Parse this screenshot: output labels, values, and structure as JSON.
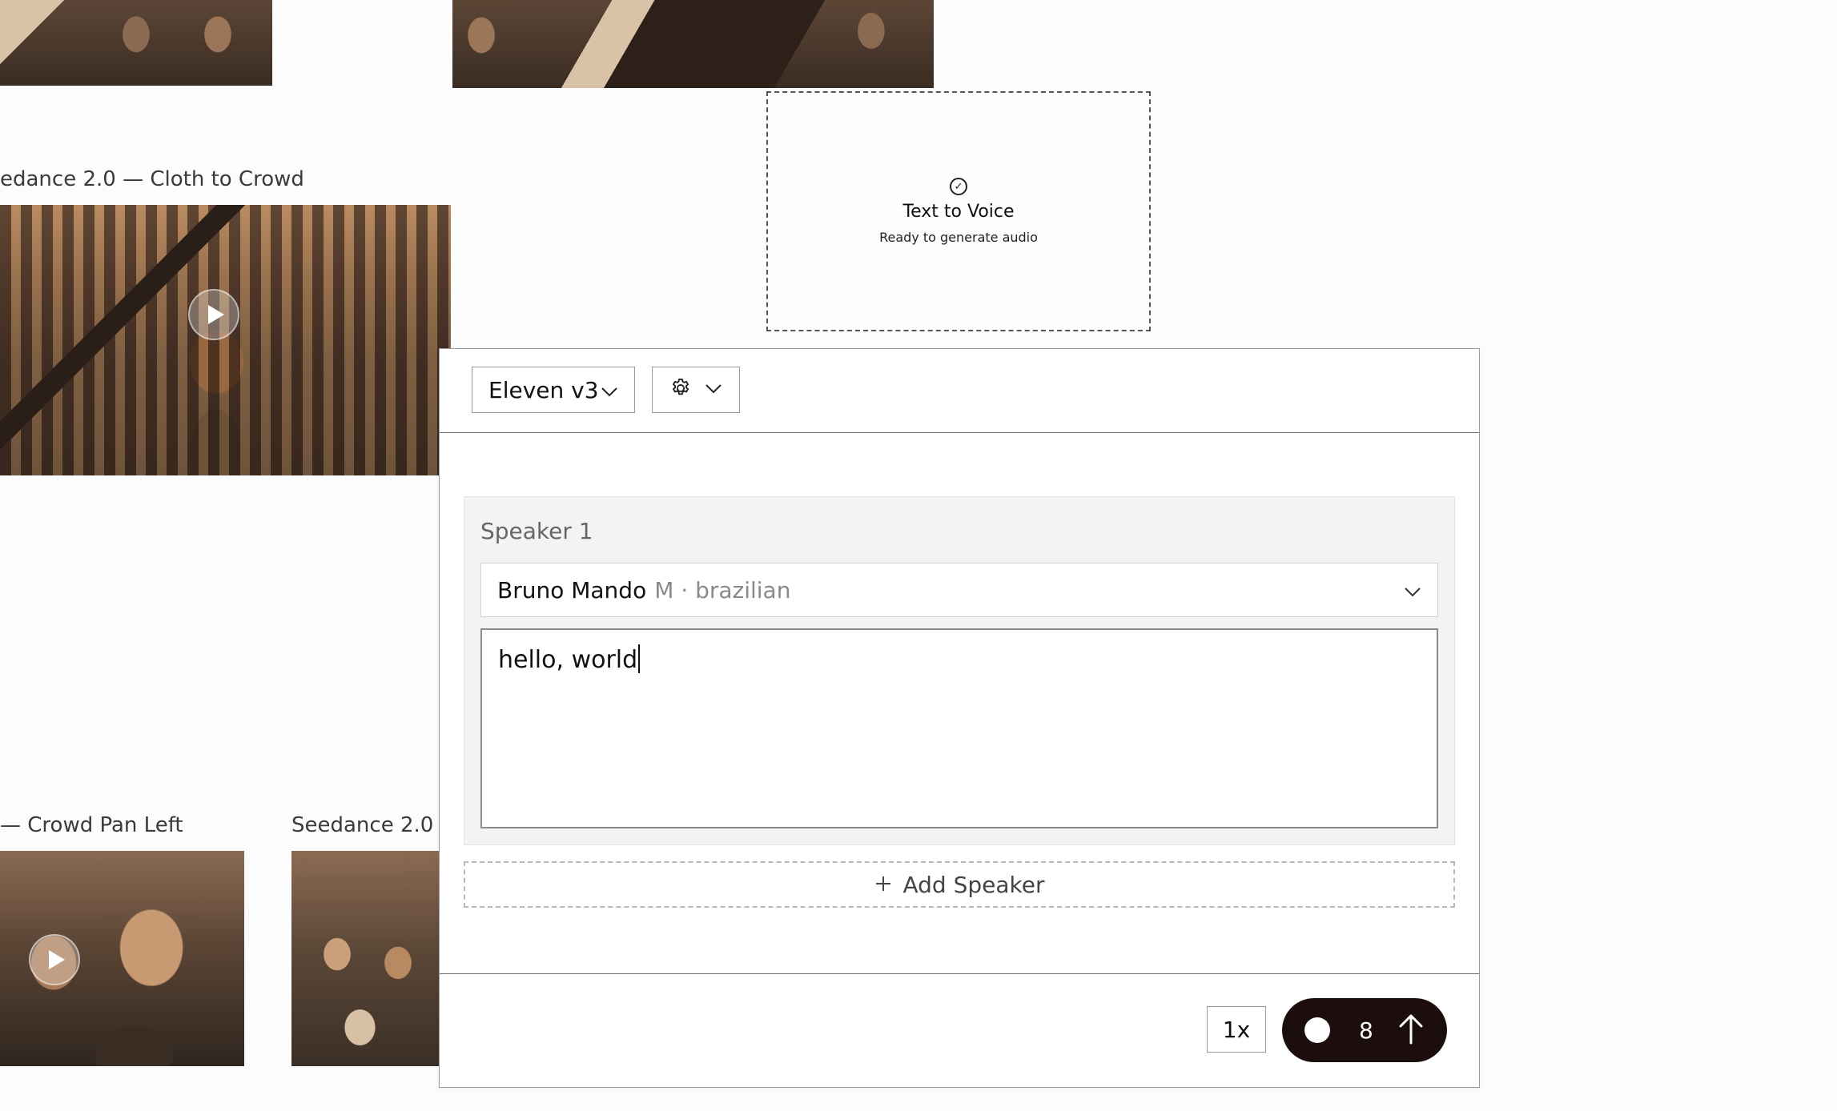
{
  "canvas": {
    "cards": [
      {
        "title": "",
        "has_play": false
      },
      {
        "title": "",
        "has_play": false
      },
      {
        "title": "edance 2.0 — Cloth to Crowd",
        "has_play": true
      },
      {
        "title": "— Crowd Pan Left",
        "has_play": true
      },
      {
        "title": "Seedance 2.0 -",
        "has_play": false
      }
    ]
  },
  "tts_node": {
    "title": "Text to Voice",
    "status": "Ready to generate audio",
    "icon": "check-circle-icon"
  },
  "panel": {
    "model": {
      "label": "Eleven v3",
      "icon": "chevron-down-icon"
    },
    "settings": {
      "icon": "gear-icon"
    },
    "speakers": [
      {
        "label": "Speaker 1",
        "voice_name": "Bruno Mando",
        "voice_meta": "M · brazilian",
        "text": "hello, world"
      }
    ],
    "add_speaker_label": "Add Speaker",
    "speed_label": "1x",
    "credits": "8"
  },
  "colors": {
    "generate_bg": "#1b0e0c",
    "panel_border": "#9a9a9a"
  }
}
